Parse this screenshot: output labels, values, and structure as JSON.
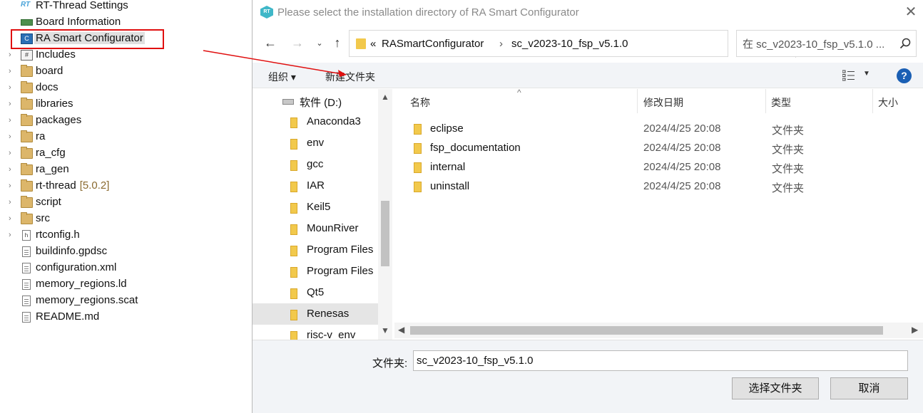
{
  "tree": {
    "items": [
      {
        "label": "RT-Thread Settings",
        "icon": "rt-icon"
      },
      {
        "label": "Board Information",
        "icon": "board-icon"
      },
      {
        "label": "RA Smart Configurator",
        "icon": "ra-icon"
      },
      {
        "label": "Includes",
        "icon": "includes-icon"
      },
      {
        "label": "board",
        "icon": "folder-icon"
      },
      {
        "label": "docs",
        "icon": "folder-icon"
      },
      {
        "label": "libraries",
        "icon": "folder-icon"
      },
      {
        "label": "packages",
        "icon": "folder-icon"
      },
      {
        "label": "ra",
        "icon": "folder-icon"
      },
      {
        "label": "ra_cfg",
        "icon": "folder-icon"
      },
      {
        "label": "ra_gen",
        "icon": "folder-icon"
      },
      {
        "label": "rt-thread",
        "version": "[5.0.2]",
        "icon": "folder-icon"
      },
      {
        "label": "script",
        "icon": "folder-icon"
      },
      {
        "label": "src",
        "icon": "folder-icon"
      },
      {
        "label": "rtconfig.h",
        "icon": "header-file-icon"
      },
      {
        "label": "buildinfo.gpdsc",
        "icon": "file-icon"
      },
      {
        "label": "configuration.xml",
        "icon": "file-icon"
      },
      {
        "label": "memory_regions.ld",
        "icon": "file-icon"
      },
      {
        "label": "memory_regions.scat",
        "icon": "file-icon"
      },
      {
        "label": "README.md",
        "icon": "file-icon"
      }
    ],
    "highlight_color": "#e01010"
  },
  "dialog": {
    "title": "Please select the installation directory of RA Smart Configurator",
    "title_icon_text": "RT",
    "address": {
      "overflow": "«",
      "segments": [
        "RASmartConfigurator",
        "sc_v2023-10_fsp_v5.1.0"
      ]
    },
    "search": {
      "placeholder": "在 sc_v2023-10_fsp_v5.1.0 ..."
    },
    "toolbar": {
      "organize": "组织 ▾",
      "new_folder": "新建文件夹"
    },
    "nav_items": [
      {
        "label": "软件 (D:)",
        "kind": "drive"
      },
      {
        "label": "Anaconda3",
        "kind": "folder"
      },
      {
        "label": "env",
        "kind": "folder"
      },
      {
        "label": "gcc",
        "kind": "folder"
      },
      {
        "label": "IAR",
        "kind": "folder"
      },
      {
        "label": "Keil5",
        "kind": "folder"
      },
      {
        "label": "MounRiver",
        "kind": "folder"
      },
      {
        "label": "Program Files",
        "kind": "folder"
      },
      {
        "label": "Program Files",
        "kind": "folder"
      },
      {
        "label": "Qt5",
        "kind": "folder"
      },
      {
        "label": "Renesas",
        "kind": "folder"
      },
      {
        "label": "risc-v_env",
        "kind": "folder"
      }
    ],
    "columns": {
      "name": "名称",
      "modified": "修改日期",
      "type": "类型",
      "size": "大小"
    },
    "files": [
      {
        "name": "eclipse",
        "modified": "2024/4/25 20:08",
        "type": "文件夹"
      },
      {
        "name": "fsp_documentation",
        "modified": "2024/4/25 20:08",
        "type": "文件夹"
      },
      {
        "name": "internal",
        "modified": "2024/4/25 20:08",
        "type": "文件夹"
      },
      {
        "name": "uninstall",
        "modified": "2024/4/25 20:08",
        "type": "文件夹"
      }
    ],
    "folder_label": "文件夹:",
    "folder_value": "sc_v2023-10_fsp_v5.1.0",
    "select_button": "选择文件夹",
    "cancel_button": "取消",
    "help_label": "?",
    "accent_color": "#1a5fb4"
  }
}
